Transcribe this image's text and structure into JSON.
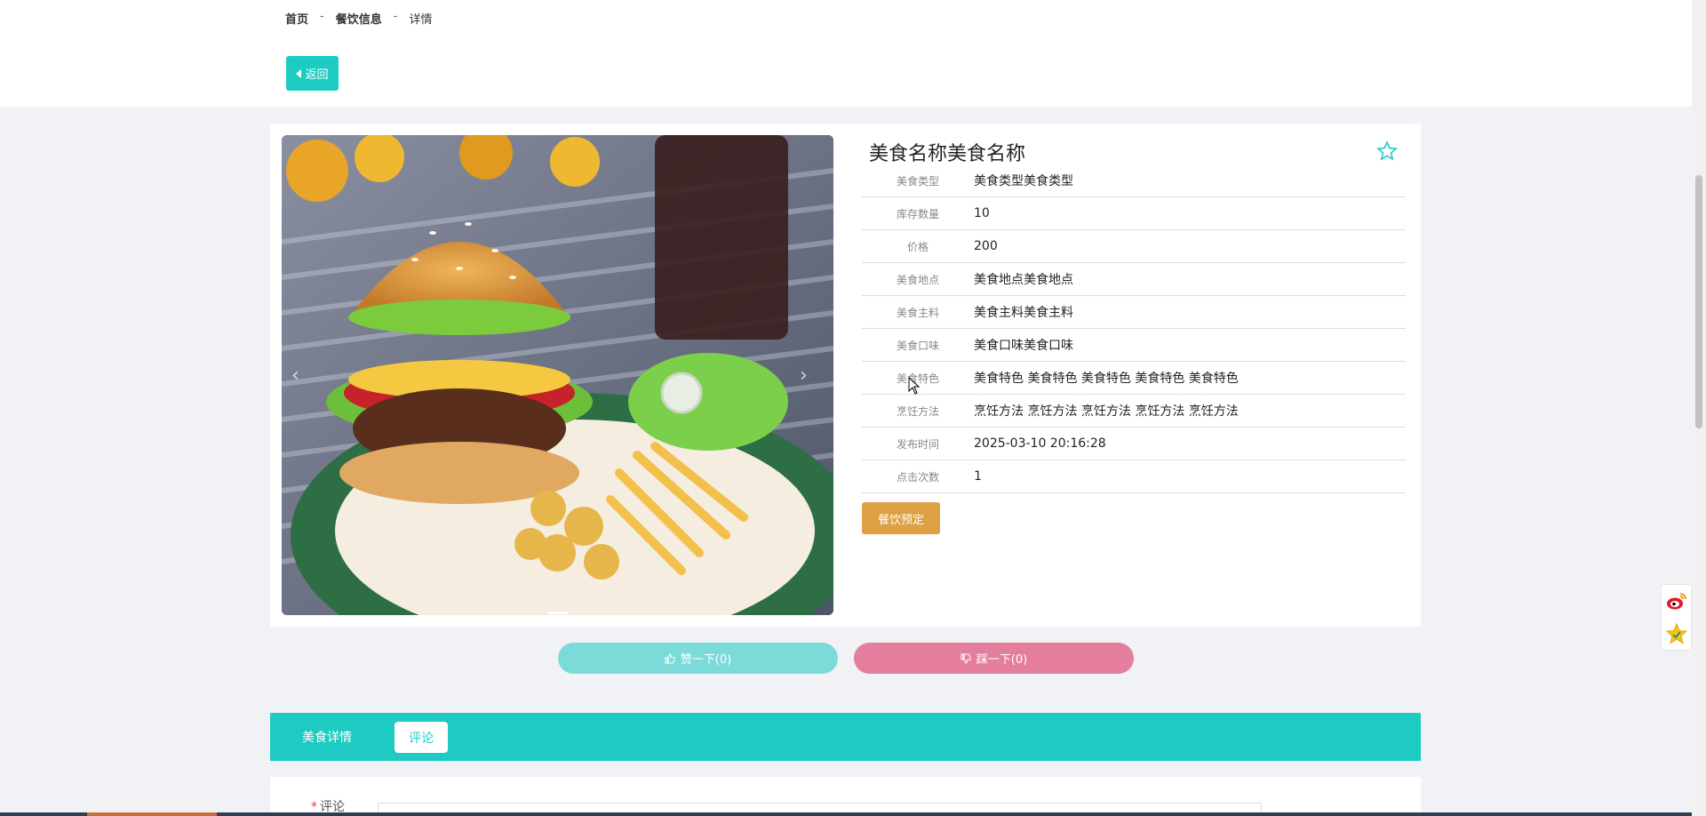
{
  "breadcrumb": {
    "home": "首页",
    "sep1": "-",
    "category": "餐饮信息",
    "sep2": "-",
    "current": "详情"
  },
  "back_button": {
    "label": "返回",
    "icon": "caret-left-icon"
  },
  "food": {
    "title": "美食名称美食名称",
    "attributes": [
      {
        "label": "美食类型",
        "value": "美食类型美食类型"
      },
      {
        "label": "库存数量",
        "value": "10"
      },
      {
        "label": "价格",
        "value": "200"
      },
      {
        "label": "美食地点",
        "value": "美食地点美食地点"
      },
      {
        "label": "美食主料",
        "value": "美食主料美食主料"
      },
      {
        "label": "美食口味",
        "value": "美食口味美食口味"
      },
      {
        "label": "美食特色",
        "value": "美食特色 美食特色 美食特色 美食特色 美食特色"
      },
      {
        "label": "烹饪方法",
        "value": "烹饪方法 烹饪方法 烹饪方法 烹饪方法 烹饪方法"
      },
      {
        "label": "发布时间",
        "value": "2025-03-10 20:16:28"
      },
      {
        "label": "点击次数",
        "value": "1"
      }
    ],
    "book_button": "餐饮预定"
  },
  "carousel": {
    "prev_icon": "‹",
    "next_icon": "›"
  },
  "reactions": {
    "like": "赞一下(0)",
    "dislike": "踩一下(0)"
  },
  "tabs": [
    {
      "label": "美食详情",
      "active": false
    },
    {
      "label": "评论",
      "active": true
    }
  ],
  "comment": {
    "required_mark": "*",
    "label": "评论"
  },
  "colors": {
    "primary": "#1ecbc3",
    "book": "#dda042",
    "like": "#7adbd8",
    "dislike": "#e57d9d",
    "background": "#f1f2f6"
  }
}
